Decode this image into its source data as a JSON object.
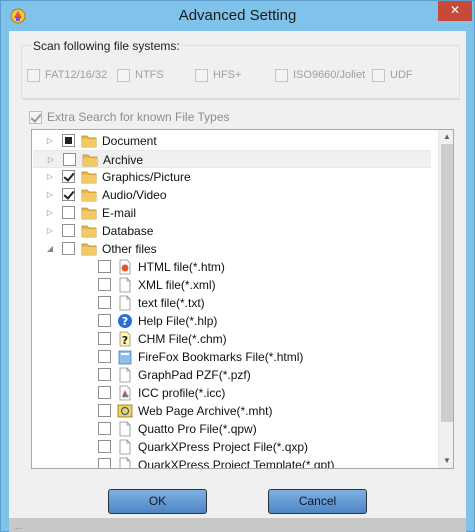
{
  "window": {
    "title": "Advanced Setting",
    "close_label": "✕",
    "footer_ghost_text": "..."
  },
  "filesystems": {
    "group_label": "Scan following file systems:",
    "options": [
      {
        "label": "FAT12/16/32",
        "checked": false,
        "enabled": false
      },
      {
        "label": "NTFS",
        "checked": false,
        "enabled": false
      },
      {
        "label": "HFS+",
        "checked": false,
        "enabled": false
      },
      {
        "label": "ISO9660/Joliet",
        "checked": false,
        "enabled": false
      },
      {
        "label": "UDF",
        "checked": false,
        "enabled": false
      }
    ]
  },
  "extra_search": {
    "label": "Extra Search for known File Types",
    "checked": true,
    "enabled": false
  },
  "tree": {
    "items": [
      {
        "label": "Document",
        "state": "partial",
        "level": 0,
        "expander": "collapsed",
        "icon": "folder-icon"
      },
      {
        "label": "Archive",
        "state": "unchecked",
        "level": 0,
        "expander": "collapsed",
        "icon": "folder-icon",
        "selected": true
      },
      {
        "label": "Graphics/Picture",
        "state": "checked",
        "level": 0,
        "expander": "collapsed",
        "icon": "folder-icon"
      },
      {
        "label": "Audio/Video",
        "state": "checked",
        "level": 0,
        "expander": "collapsed",
        "icon": "folder-icon"
      },
      {
        "label": "E-mail",
        "state": "unchecked",
        "level": 0,
        "expander": "collapsed",
        "icon": "folder-icon"
      },
      {
        "label": "Database",
        "state": "unchecked",
        "level": 0,
        "expander": "collapsed",
        "icon": "folder-icon"
      },
      {
        "label": "Other files",
        "state": "unchecked",
        "level": 0,
        "expander": "expanded",
        "icon": "folder-icon"
      },
      {
        "label": "HTML file(*.htm)",
        "state": "unchecked",
        "level": 1,
        "icon": "html-file-icon"
      },
      {
        "label": "XML file(*.xml)",
        "state": "unchecked",
        "level": 1,
        "icon": "document-icon"
      },
      {
        "label": "text file(*.txt)",
        "state": "unchecked",
        "level": 1,
        "icon": "document-icon"
      },
      {
        "label": "Help File(*.hlp)",
        "state": "unchecked",
        "level": 1,
        "icon": "help-icon"
      },
      {
        "label": "CHM File(*.chm)",
        "state": "unchecked",
        "level": 1,
        "icon": "chm-help-icon"
      },
      {
        "label": "FireFox Bookmarks File(*.html)",
        "state": "unchecked",
        "level": 1,
        "icon": "bookmarks-file-icon"
      },
      {
        "label": "GraphPad PZF(*.pzf)",
        "state": "unchecked",
        "level": 1,
        "icon": "document-icon"
      },
      {
        "label": "ICC profile(*.icc)",
        "state": "unchecked",
        "level": 1,
        "icon": "color-profile-icon"
      },
      {
        "label": "Web Page Archive(*.mht)",
        "state": "unchecked",
        "level": 1,
        "icon": "web-archive-icon"
      },
      {
        "label": "Quatto Pro File(*.qpw)",
        "state": "unchecked",
        "level": 1,
        "icon": "document-icon"
      },
      {
        "label": "QuarkXPress Project File(*.qxp)",
        "state": "unchecked",
        "level": 1,
        "icon": "document-icon"
      },
      {
        "label": "QuarkXPress Project Template(*.qpt)",
        "state": "unchecked",
        "level": 1,
        "icon": "document-icon"
      }
    ]
  },
  "buttons": {
    "ok_label": "OK",
    "cancel_label": "Cancel"
  },
  "colors": {
    "title_bar": "#7fc3eb",
    "close_button": "#c7493a",
    "button_fill": "#5b91cf",
    "folder": "#e8b64a"
  }
}
